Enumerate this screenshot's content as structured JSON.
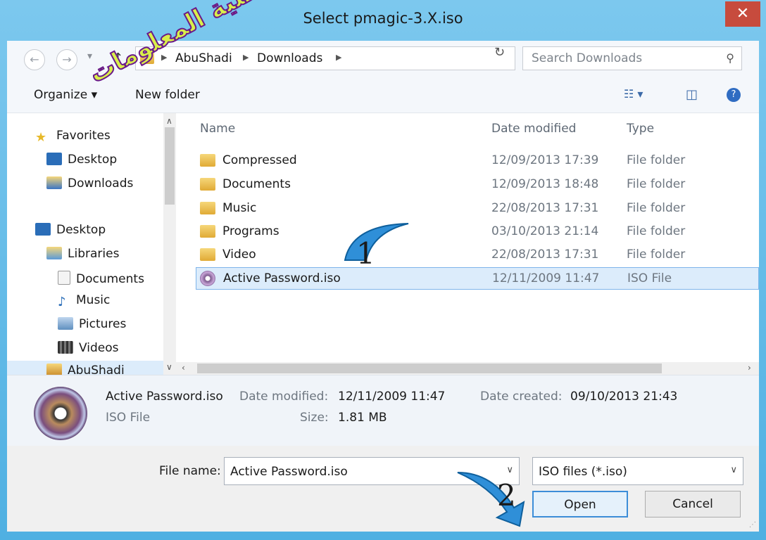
{
  "window": {
    "title": "Select pmagic-3.X.iso",
    "close_label": "✕"
  },
  "address": {
    "breadcrumbs": [
      "AbuShadi",
      "Downloads"
    ],
    "search_placeholder": "Search Downloads"
  },
  "toolbar": {
    "organize_label": "Organize ▾",
    "new_folder_label": "New folder"
  },
  "nav": {
    "items": [
      {
        "label": "Favorites",
        "icon": "star-icon"
      },
      {
        "label": "Desktop",
        "icon": "desktop-icon"
      },
      {
        "label": "Downloads",
        "icon": "downloads-folder-icon"
      },
      {
        "label": "Desktop",
        "icon": "desktop-icon"
      },
      {
        "label": "Libraries",
        "icon": "libraries-icon"
      },
      {
        "label": "Documents",
        "icon": "documents-icon"
      },
      {
        "label": "Music",
        "icon": "music-icon"
      },
      {
        "label": "Pictures",
        "icon": "pictures-icon"
      },
      {
        "label": "Videos",
        "icon": "videos-icon"
      },
      {
        "label": "AbuShadi",
        "icon": "user-folder-icon"
      }
    ]
  },
  "list": {
    "columns": [
      "Name",
      "Date modified",
      "Type"
    ],
    "rows": [
      {
        "name": "Compressed",
        "date": "12/09/2013 17:39",
        "type": "File folder"
      },
      {
        "name": "Documents",
        "date": "12/09/2013 18:48",
        "type": "File folder"
      },
      {
        "name": "Music",
        "date": "22/08/2013 17:31",
        "type": "File folder"
      },
      {
        "name": "Programs",
        "date": "03/10/2013 21:14",
        "type": "File folder"
      },
      {
        "name": "Video",
        "date": "22/08/2013 17:31",
        "type": "File folder"
      },
      {
        "name": "Active Password.iso",
        "date": "12/11/2009 11:47",
        "type": "ISO File"
      }
    ]
  },
  "details": {
    "filename": "Active Password.iso",
    "filetype": "ISO File",
    "date_modified_label": "Date modified:",
    "date_modified": "12/11/2009 11:47",
    "size_label": "Size:",
    "size": "1.81 MB",
    "date_created_label": "Date created:",
    "date_created": "09/10/2013 21:43"
  },
  "bottom": {
    "filename_label": "File name:",
    "filename_value": "Active Password.iso",
    "filter_value": "ISO files (*.iso)",
    "open_label": "Open",
    "cancel_label": "Cancel"
  },
  "annotations": {
    "step1": "1",
    "step2": "2",
    "watermark_text": "سفراء تقنية المعلومات"
  }
}
